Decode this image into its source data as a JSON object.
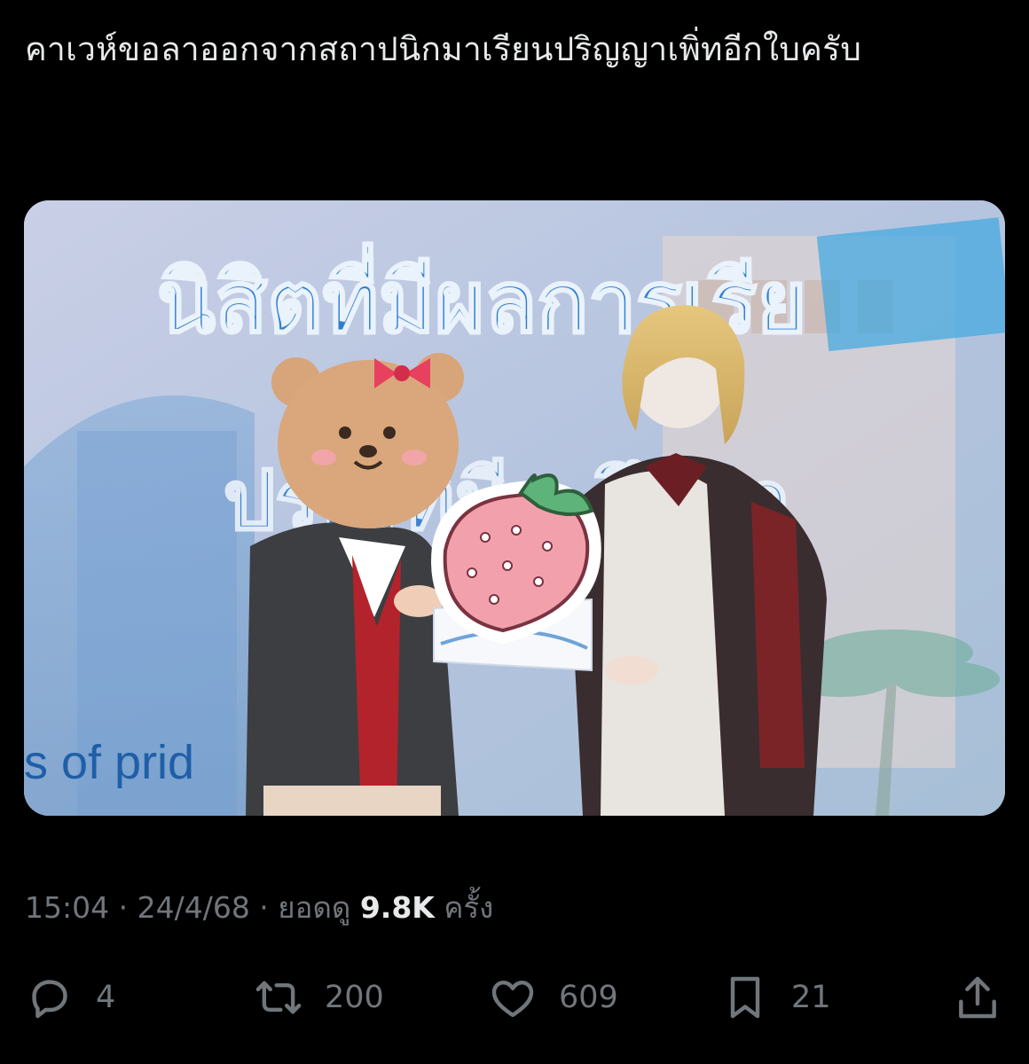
{
  "tweet": {
    "text": "คาเวห์ขอลาออกจากสถาปนิกมาเรียนปริญญาเพิ่ทอีกใบครับ"
  },
  "media": {
    "banner_title": "นิสิตที่มีผลการเรีย",
    "banner_line2": "ปร…ที่มี…ศึกษา",
    "banner_footer": "s of prid",
    "sticker_face": "bear-sticker-icon",
    "sticker_fruit": "strawberry-sticker-icon"
  },
  "meta": {
    "time": "15:04",
    "separator": " · ",
    "date": "24/4/68",
    "views_label": "ยอดดู",
    "views_count": "9.8K",
    "views_unit": "ครั้ง"
  },
  "actions": {
    "reply": {
      "icon": "reply-icon",
      "count": "4"
    },
    "retweet": {
      "icon": "retweet-icon",
      "count": "200"
    },
    "like": {
      "icon": "heart-icon",
      "count": "609"
    },
    "bookmark": {
      "icon": "bookmark-icon",
      "count": "21"
    },
    "share": {
      "icon": "share-icon"
    }
  },
  "colors": {
    "background": "#000000",
    "text_primary": "#e7e9ea",
    "text_secondary": "#71767b"
  }
}
